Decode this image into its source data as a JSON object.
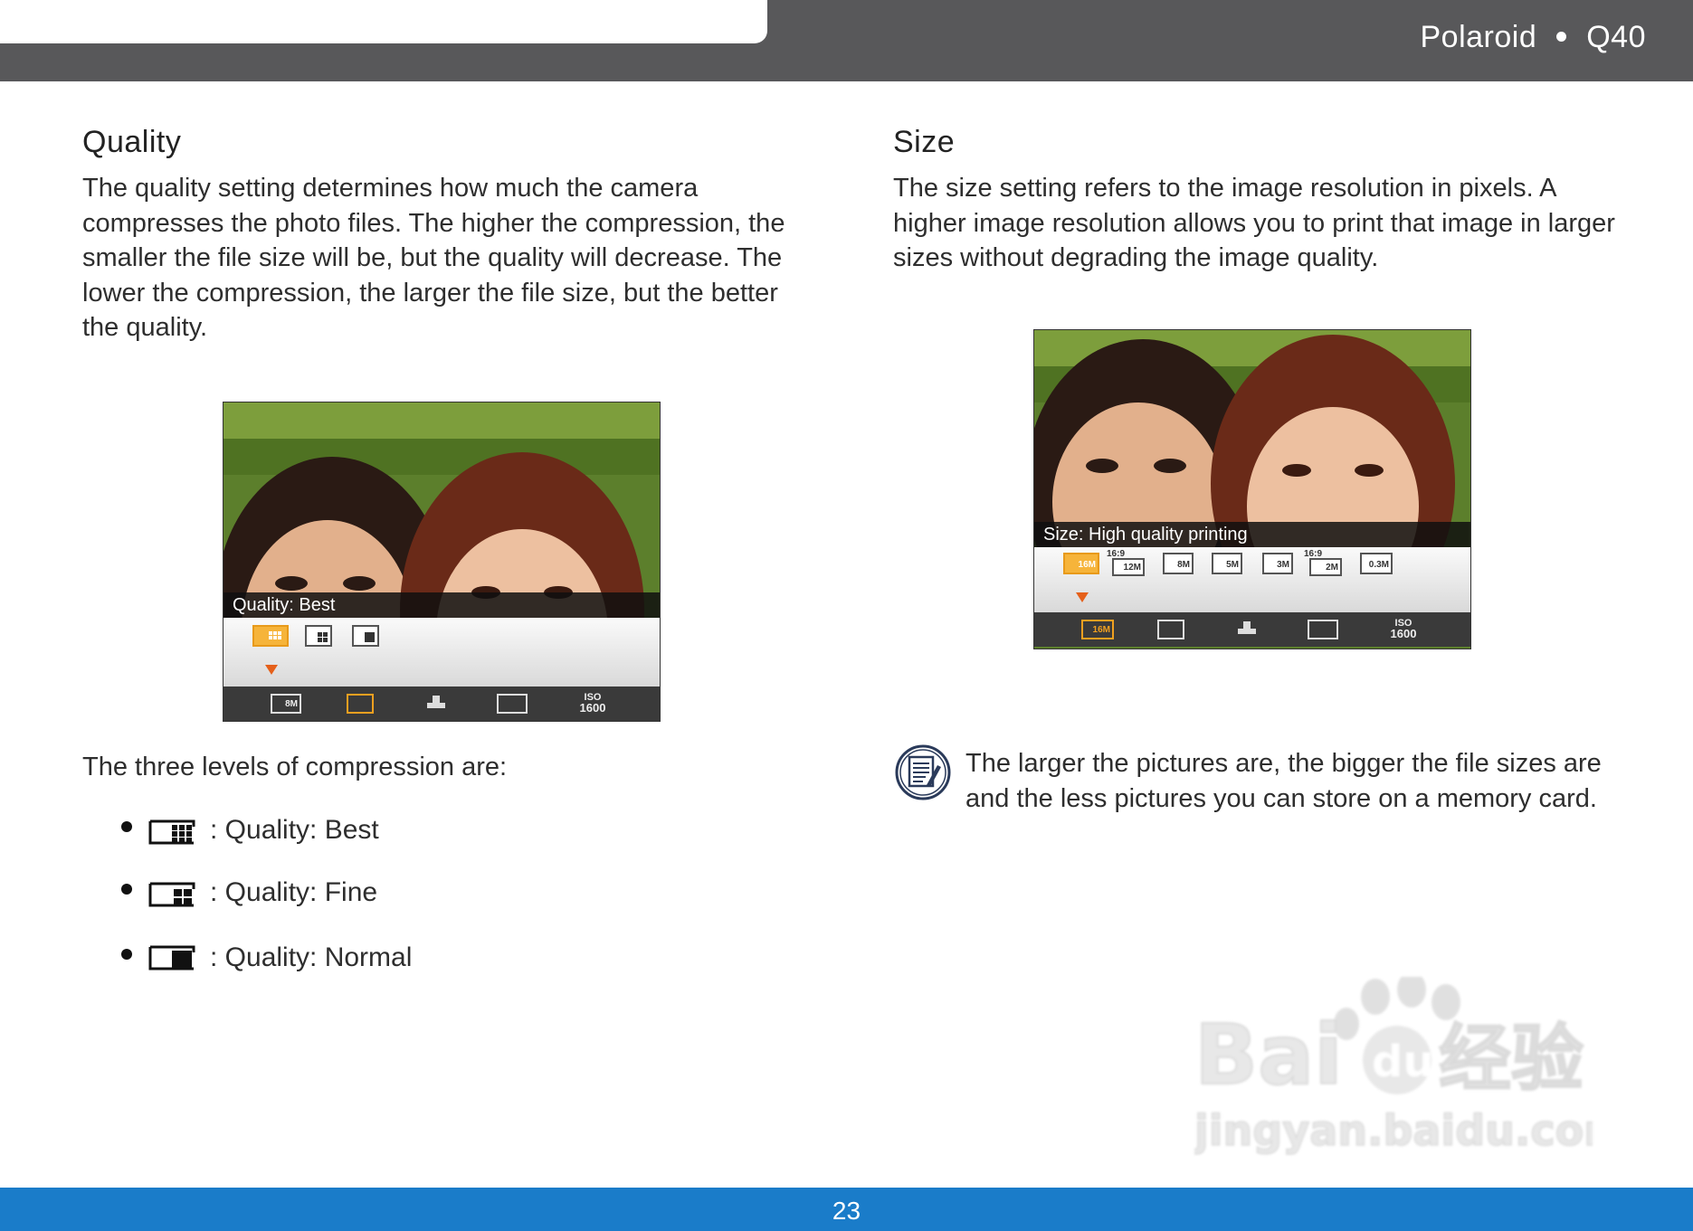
{
  "header": {
    "brand": "Polaroid",
    "model": "Q40"
  },
  "quality": {
    "title": "Quality",
    "body": "The quality setting determines how much the camera compresses the photo files.  The higher the compression, the smaller the file size will be, but the quality will decrease.  The lower the compression, the larger the file size, but the better the quality.",
    "screen_label": "Quality: Best",
    "menu_labels": [
      "8M",
      "ISO",
      "1600"
    ],
    "levels_intro": "The three levels of compression are:",
    "levels": [
      {
        "label": ": Quality: Best"
      },
      {
        "label": ": Quality: Fine"
      },
      {
        "label": ": Quality: Normal"
      }
    ]
  },
  "size": {
    "title": "Size",
    "body": "The size setting refers to the image resolution  in pixels. A higher image resolution allows you to print that image in larger sizes without degrading the image quality.",
    "screen_label": "Size: High quality printing",
    "menu_items": [
      "16M",
      "12M",
      "8M",
      "5M",
      "3M",
      "2M",
      "0.3M"
    ],
    "ratio_label": "16:9",
    "bottom_selected": "16M",
    "iso_label": "ISO",
    "iso_value": "1600"
  },
  "note": {
    "text": "The larger the pictures are, the bigger the file sizes are and the less pictures you can store on a memory card."
  },
  "footer": {
    "page_number": "23"
  },
  "watermark": {
    "brand": "Bai",
    "brand2": "du",
    "cn": "经验",
    "url": "jingyan.baidu.com"
  },
  "colors": {
    "header": "#58585a",
    "footer": "#1a7cc9",
    "selected": "#f0a020",
    "arrow": "#e5601a"
  }
}
